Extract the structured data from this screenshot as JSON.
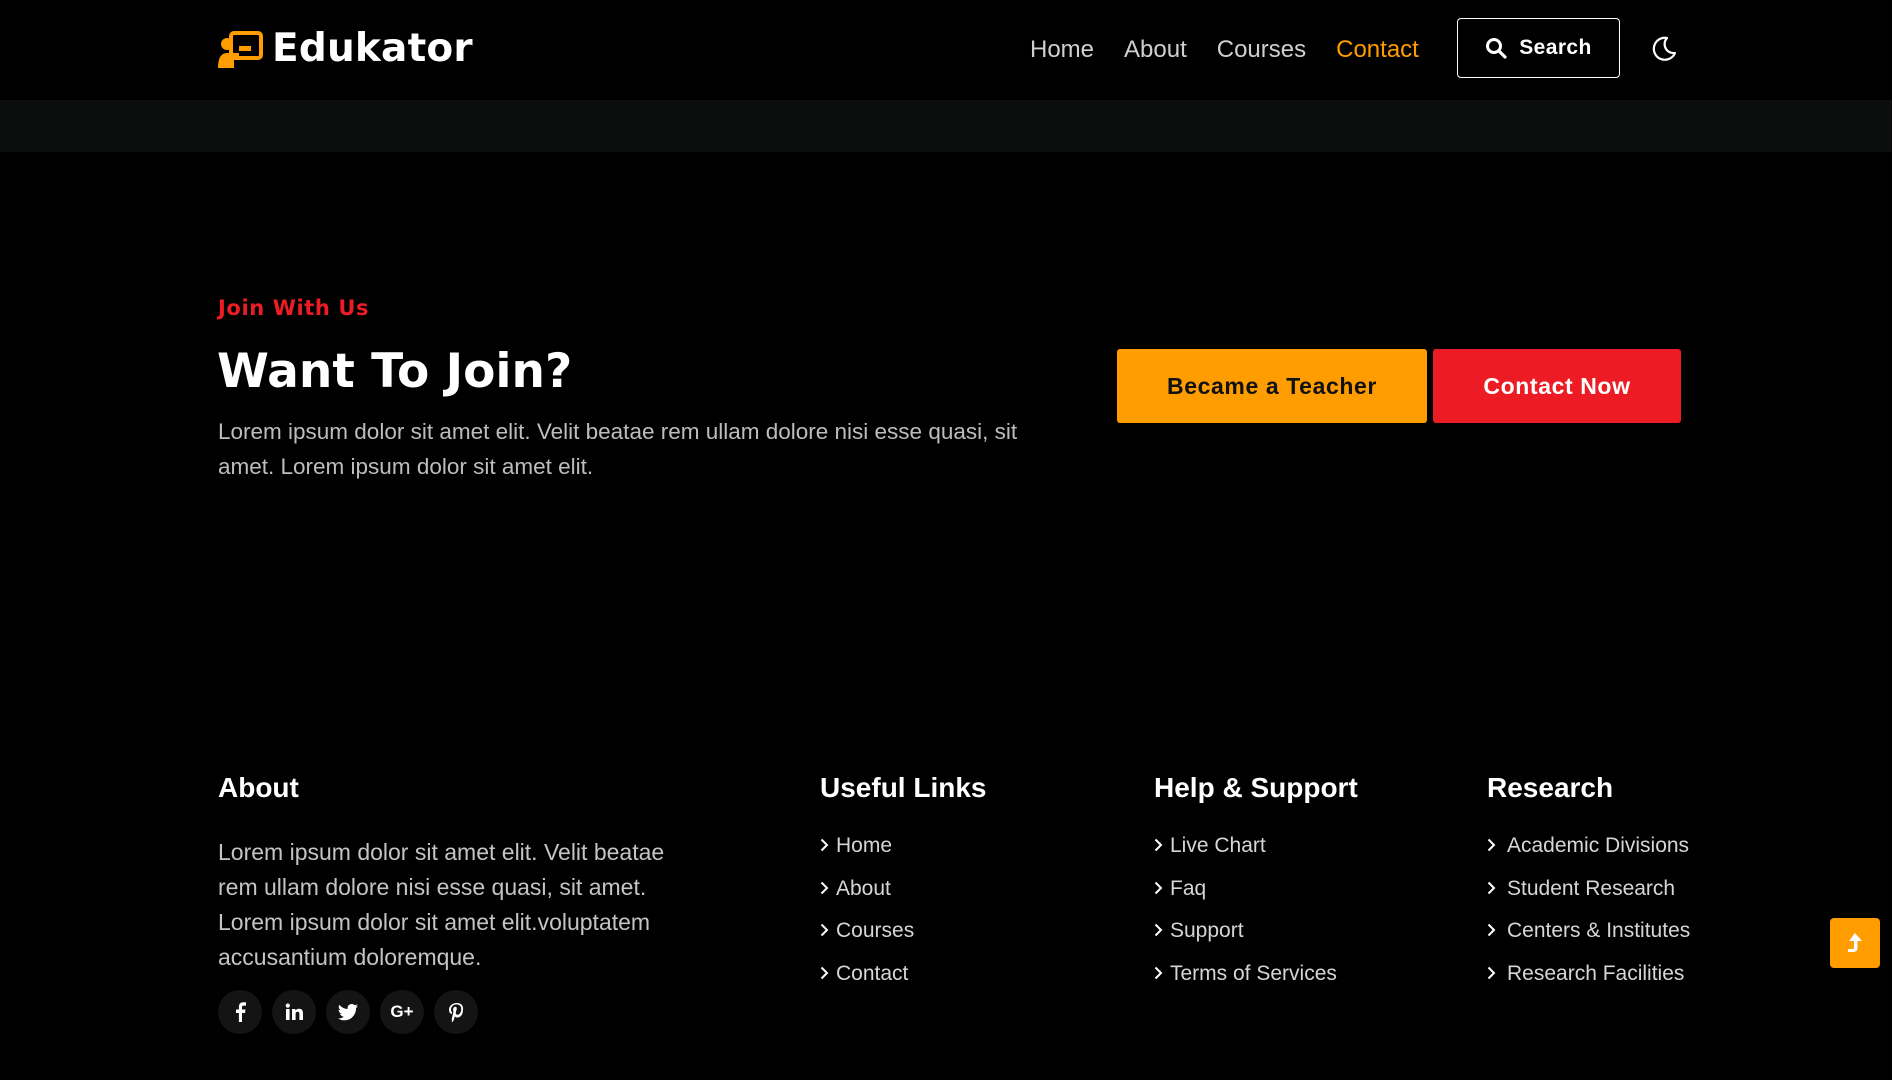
{
  "brand": {
    "name": "Edukator",
    "accent": "#ff9d00",
    "red": "#ed1c24"
  },
  "nav": {
    "items": [
      {
        "label": "Home"
      },
      {
        "label": "About"
      },
      {
        "label": "Courses"
      },
      {
        "label": "Contact"
      }
    ],
    "active": "Contact",
    "search_label": "Search",
    "theme_icon": "moon-icon"
  },
  "join": {
    "kicker": "Join With Us",
    "title": "Want To Join?",
    "text": "Lorem ipsum dolor sit amet elit. Velit beatae rem ullam dolore nisi esse quasi, sit amet. Lorem ipsum dolor sit amet elit.",
    "teacher_button": "Became a Teacher",
    "contact_button": "Contact Now"
  },
  "footer": {
    "about": {
      "heading": "About",
      "text": "Lorem ipsum dolor sit amet elit. Velit beatae rem ullam dolore nisi esse quasi, sit amet. Lorem ipsum dolor sit amet elit.voluptatem accusantium doloremque.",
      "socials": [
        "facebook-icon",
        "linkedin-icon",
        "twitter-icon",
        "google-plus-icon",
        "pinterest-icon"
      ]
    },
    "useful_links": {
      "heading": "Useful Links",
      "items": [
        "Home",
        "About",
        "Courses",
        "Contact"
      ]
    },
    "help_support": {
      "heading": "Help & Support",
      "items": [
        "Live Chart",
        "Faq",
        "Support",
        "Terms of Services"
      ]
    },
    "research": {
      "heading": "Research",
      "items": [
        "Academic Divisions",
        "Student Research",
        "Centers & Institutes",
        "Research Facilities"
      ]
    }
  },
  "back_to_top_icon": "arrow-up-icon"
}
